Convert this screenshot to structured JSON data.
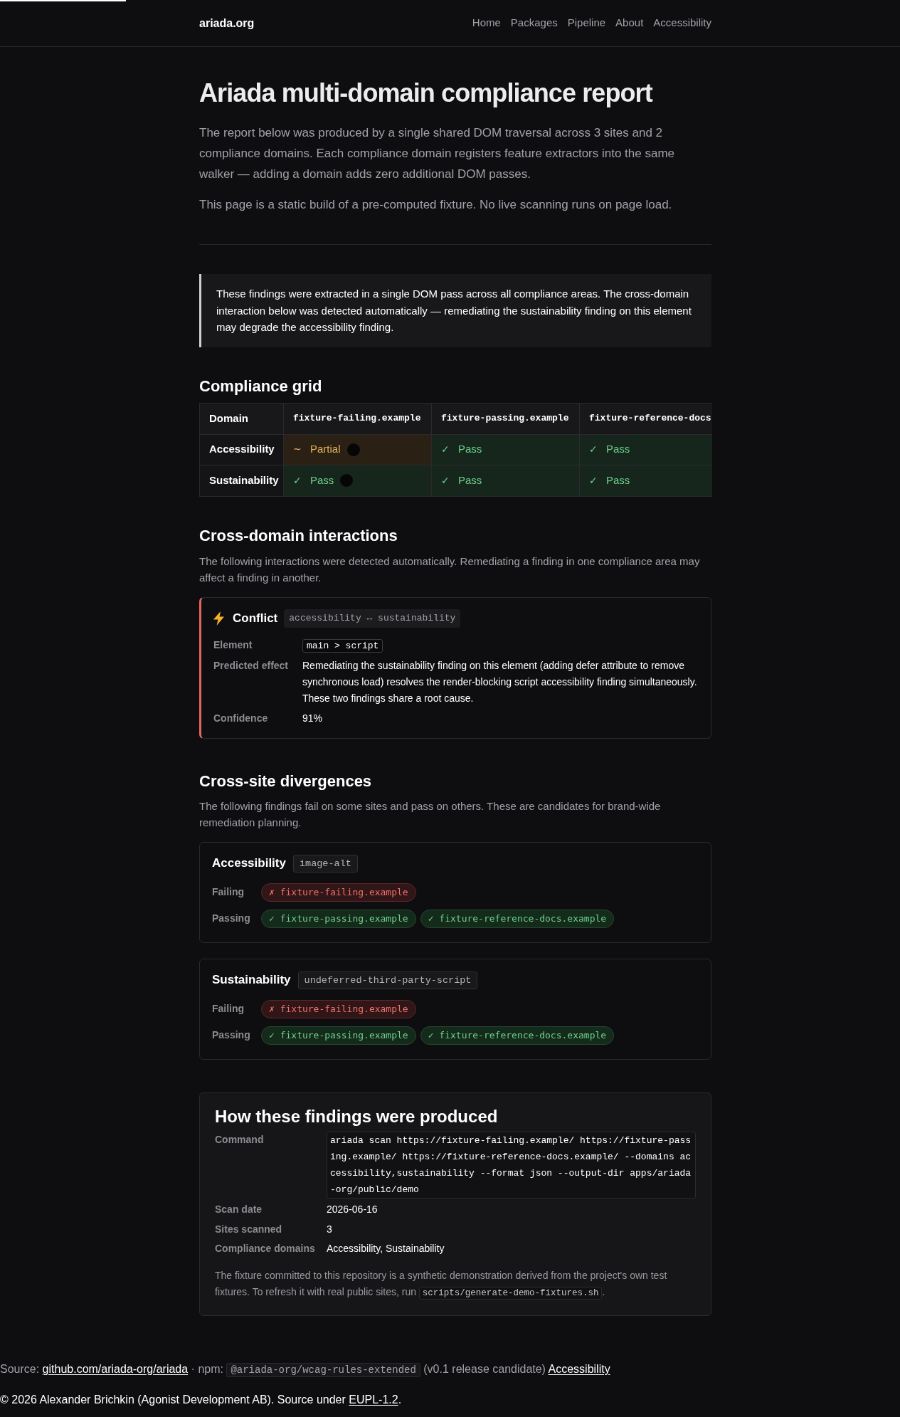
{
  "loading_bar": {
    "level": 0.14
  },
  "header": {
    "site_name": "ariada.org",
    "nav": [
      {
        "label": "Home"
      },
      {
        "label": "Packages"
      },
      {
        "label": "Pipeline"
      },
      {
        "label": "About"
      },
      {
        "label": "Accessibility"
      }
    ]
  },
  "intro": {
    "title": "Ariada multi-domain compliance report",
    "paragraphs": [
      "The report below was produced by a single shared DOM traversal across 3 sites and 2 compliance domains. Each compliance domain registers feature extractors into the same walker — adding a domain adds zero additional DOM passes.",
      "This page is a static build of a pre-computed fixture. No live scanning runs on page load."
    ]
  },
  "callout": {
    "text": "These findings were extracted in a single DOM pass across all compliance areas. The cross-domain interaction below was detected automatically — remediating the sustainability finding on this element may degrade the accessibility finding."
  },
  "compliance_grid": {
    "heading": "Compliance grid",
    "columns": [
      "Domain",
      "fixture-failing.example",
      "fixture-passing.example",
      "fixture-reference-docs"
    ],
    "rows": [
      {
        "cells": [
          {
            "kind": "domain",
            "label": "Accessibility"
          },
          {
            "kind": "partial",
            "symbol": "~",
            "label": "Partial",
            "marker": true
          },
          {
            "kind": "pass",
            "symbol": "✓",
            "label": "Pass",
            "marker": false
          },
          {
            "kind": "pass",
            "symbol": "✓",
            "label": "Pass",
            "marker": false
          }
        ]
      },
      {
        "cells": [
          {
            "kind": "domain",
            "label": "Sustainability"
          },
          {
            "kind": "pass",
            "symbol": "✓",
            "label": "Pass",
            "marker": true
          },
          {
            "kind": "pass",
            "symbol": "✓",
            "label": "Pass",
            "marker": false
          },
          {
            "kind": "pass",
            "symbol": "✓",
            "label": "Pass",
            "marker": false
          }
        ]
      }
    ]
  },
  "interactions": {
    "heading": "Cross-domain interactions",
    "description": "The following interactions were detected automatically. Remediating a finding in one compliance area may affect a finding in another.",
    "items": [
      {
        "kind": "conflict",
        "title": "Conflict",
        "domains": "accessibility ↔ sustainability",
        "fields": [
          {
            "label": "Element",
            "kind": "code",
            "value": "main > script"
          },
          {
            "label": "Predicted effect",
            "kind": "text",
            "value": "Remediating the sustainability finding on this element (adding defer attribute to remove synchronous load) resolves the render-blocking script accessibility finding simultaneously. These two findings share a root cause."
          },
          {
            "label": "Confidence",
            "kind": "text",
            "value": "91%"
          }
        ]
      }
    ]
  },
  "divergences": {
    "heading": "Cross-site divergences",
    "description": "The following findings fail on some sites and pass on others. These are candidates for brand-wide remediation planning.",
    "items": [
      {
        "domain": "Accessibility",
        "rule": "image-alt",
        "groups": [
          {
            "label": "Failing",
            "kind": "fail",
            "sites": [
              "✗ fixture-failing.example"
            ]
          },
          {
            "label": "Passing",
            "kind": "pass",
            "sites": [
              "✓ fixture-passing.example",
              "✓ fixture-reference-docs.example"
            ]
          }
        ]
      },
      {
        "domain": "Sustainability",
        "rule": "undeferred-third-party-script",
        "groups": [
          {
            "label": "Failing",
            "kind": "fail",
            "sites": [
              "✗ fixture-failing.example"
            ]
          },
          {
            "label": "Passing",
            "kind": "pass",
            "sites": [
              "✓ fixture-passing.example",
              "✓ fixture-reference-docs.example"
            ]
          }
        ]
      }
    ]
  },
  "provenance": {
    "heading": "How these findings were produced",
    "fields": [
      {
        "label": "Command",
        "kind": "code",
        "value": "ariada scan https://fixture-failing.example/ https://fixture-passing.example/ https://fixture-reference-docs.example/ --domains accessibility,sustainability --format json --output-dir apps/ariada-org/public/demo"
      },
      {
        "label": "Scan date",
        "kind": "text",
        "value": "2026-06-16"
      },
      {
        "label": "Sites scanned",
        "kind": "text",
        "value": "3"
      },
      {
        "label": "Compliance domains",
        "kind": "text",
        "value": "Accessibility, Sustainability"
      }
    ],
    "note": [
      {
        "kind": "text",
        "text": "The fixture committed to this repository is a synthetic demonstration derived from the project's own test fixtures. To refresh it with real public sites, run "
      },
      {
        "kind": "code",
        "text": "scripts/generate-demo-fixtures.sh"
      },
      {
        "kind": "text",
        "text": "."
      }
    ]
  },
  "footer": {
    "lines": [
      [
        {
          "kind": "text",
          "text": "Source: "
        },
        {
          "kind": "link",
          "text": "github.com/ariada-org/ariada"
        },
        {
          "kind": "text",
          "text": " · npm: "
        },
        {
          "kind": "code",
          "text": "@ariada-org/wcag-rules-extended"
        },
        {
          "kind": "text",
          "text": " (v0.1 release candidate) "
        },
        {
          "kind": "link",
          "text": "Accessibility"
        }
      ],
      [
        {
          "kind": "text",
          "text": "© 2026 Alexander Brichkin (Agonist Development AB). Source under "
        },
        {
          "kind": "link",
          "text": "EUPL-1.2"
        },
        {
          "kind": "text",
          "text": "."
        }
      ]
    ]
  }
}
